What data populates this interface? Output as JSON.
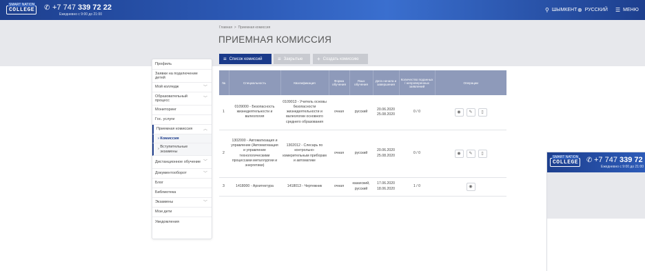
{
  "header": {
    "logo_top": "SMART NATION",
    "logo": "COLLEGE",
    "phone_prefix": "+7 747 ",
    "phone_main": "339 72 22",
    "hours": "Ежедневно с 9:00 до 21:00",
    "city": "ШЫМКЕНТ",
    "language": "РУССКИЙ",
    "menu": "МЕНЮ"
  },
  "breadcrumb": {
    "home": "Главная",
    "sep": ">",
    "current": "Приемная комиссия"
  },
  "page_title": "ПРИЕМНАЯ КОМИССИЯ",
  "toolbar": {
    "list_label": "Список комиссий",
    "closed_label": "Закрытые",
    "create_label": "Создать комиссию"
  },
  "sidebar": {
    "items": [
      {
        "label": "Профиль"
      },
      {
        "label": "Заявки на подключение детей"
      },
      {
        "label": "Мой колледж"
      },
      {
        "label": "Образовательный процесс"
      },
      {
        "label": "Мониторинг"
      },
      {
        "label": "Гос. услуги"
      },
      {
        "label": "Приемная комиссия"
      },
      {
        "label": "Комиссия"
      },
      {
        "label": "Вступительные экзамены"
      },
      {
        "label": "Дистанционное обучение"
      },
      {
        "label": "Документооборот"
      },
      {
        "label": "Блог"
      },
      {
        "label": "Библиотека"
      },
      {
        "label": "Экзамены"
      },
      {
        "label": "Мои дети"
      },
      {
        "label": "Уведомления"
      }
    ]
  },
  "table": {
    "columns": [
      "№",
      "Специальность",
      "Квалификация",
      "Форма обучения",
      "Язык обучения",
      "Дата начала и завершения",
      "Количество поданных / непроверенных заявлений",
      "Операции"
    ],
    "rows": [
      {
        "n": "1",
        "spec": "0109000 - Безопасность жизнедеятельности и валеология",
        "qual": "0109013 - Учитель основы безопасности жизнедеятельности и валеологии основного среднего образования",
        "form": "очная",
        "lang": "русский",
        "start": "20.06.2020",
        "end": "25.08.2020",
        "count": "0 / 0"
      },
      {
        "n": "2",
        "spec": "1302000 - Автоматизация и управление (Автоматизация и управление технологическими процессами металлургии и энергетики)",
        "qual": "1302012 - Слесарь по контрольно-измерительным приборам и автоматике",
        "form": "очная",
        "lang": "русский",
        "start": "20.06.2020",
        "end": "25.08.2020",
        "count": "0 / 0"
      },
      {
        "n": "3",
        "spec": "1418000 - Архитектура",
        "qual": "1418013 - Чертежник",
        "form": "очная",
        "lang": "казахский, русский",
        "start": "17.06.2020",
        "end": "18.06.2020",
        "count": "1 / 0"
      }
    ]
  },
  "icons": {
    "eye": "eye-icon",
    "edit": "pencil-icon",
    "delete": "trash-icon"
  },
  "colors": {
    "brand": "#1a3a8a",
    "header": "#2d5bb8",
    "table_head": "#8e9aba"
  }
}
